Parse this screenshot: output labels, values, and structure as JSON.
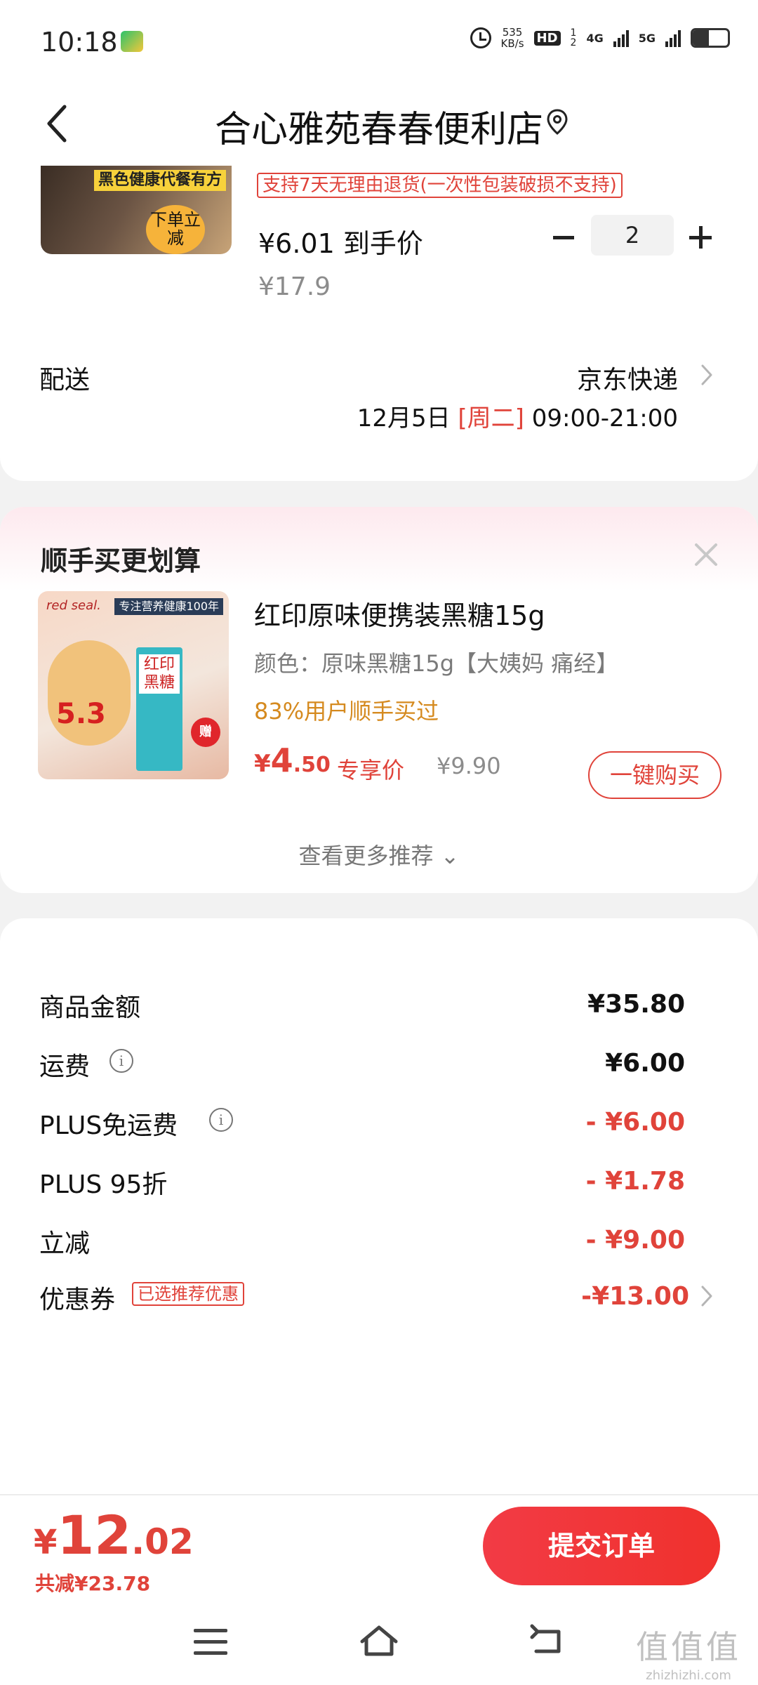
{
  "status_bar": {
    "time": "10:18",
    "net_speed_value": "535",
    "net_speed_unit": "KB/s",
    "hd": "HD",
    "sim1": "1",
    "sim2": "2",
    "network_1": "4G",
    "network_2": "5G",
    "battery_level": 0.45
  },
  "header": {
    "title": "合心雅苑春春便利店"
  },
  "product": {
    "thumb_tag": "黑色健康代餐有方",
    "thumb_badge": "下单立减",
    "return_policy": "支持7天无理由退货(一次性包装破损不支持)",
    "deal_price": "¥6.01 到手价",
    "original_price": "¥17.9",
    "quantity": "2"
  },
  "delivery": {
    "label": "配送",
    "carrier": "京东快递",
    "date": "12月5日",
    "weekday": "[周二]",
    "time_window": "09:00-21:00"
  },
  "recommend": {
    "title": "顺手买更划算",
    "image": {
      "brand": "red seal.",
      "tag": "专注营养健康100年",
      "promo_value": "5.3",
      "package_text": "红印黑糖",
      "gift": "赠"
    },
    "item_name": "红印原味便携装黑糖15g",
    "spec": "颜色：原味黑糖15g【大姨妈 痛经】",
    "social_proof": "83%用户顺手买过",
    "price_currency": "¥",
    "price_int": "4",
    "price_dec": ".50",
    "price_label": "专享价",
    "old_price": "¥9.90",
    "buy_button": "一键购买",
    "more_link": "查看更多推荐 ⌄"
  },
  "summary": {
    "rows": [
      {
        "label": "商品金额",
        "value": "¥35.80"
      },
      {
        "label": "运费",
        "value": "¥6.00"
      },
      {
        "label": "PLUS免运费",
        "value": "- ¥6.00"
      },
      {
        "label": "PLUS 95折",
        "value": "- ¥1.78"
      },
      {
        "label": "立减",
        "value": "- ¥9.00"
      },
      {
        "label": "优惠券",
        "value": "-¥13.00",
        "tag": "已选推荐优惠"
      }
    ]
  },
  "bottom": {
    "total_currency": "¥",
    "total_int": "12",
    "total_dec": ".02",
    "saved": "共减¥23.78",
    "submit_label": "提交订单"
  },
  "watermark": {
    "logo": "值值值",
    "url": "zhizhizhi.com"
  },
  "colors": {
    "accent": "#e0433a",
    "submit_button": "#f23b45",
    "social_proof": "#d58a1f"
  }
}
